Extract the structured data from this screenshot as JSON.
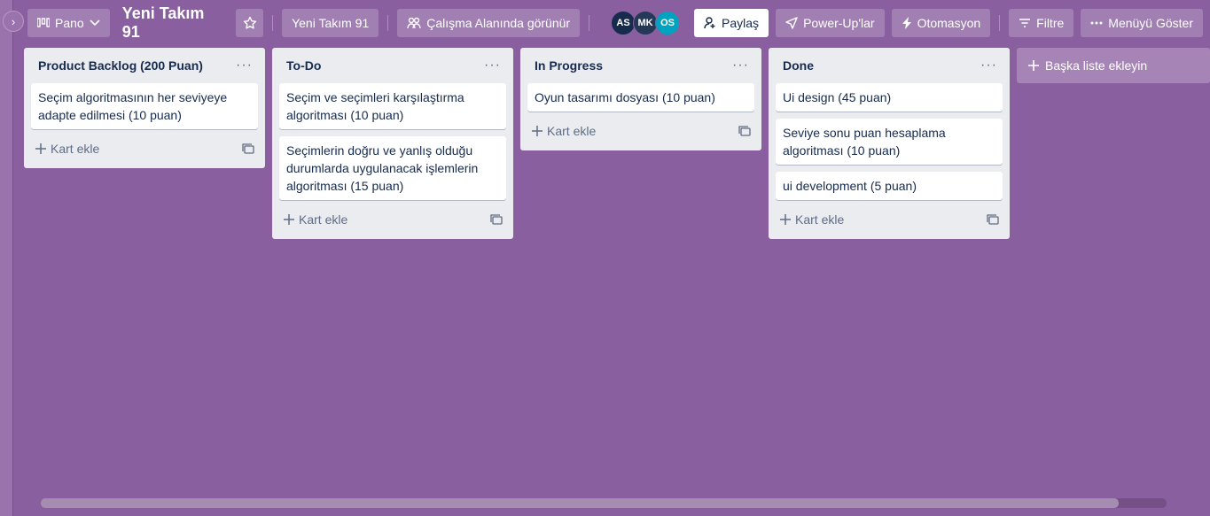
{
  "topbar": {
    "view_label": "Pano",
    "board_title": "Yeni Takım 91",
    "workspace_label": "Yeni Takım 91",
    "visibility_label": "Çalışma Alanında görünür",
    "share_label": "Paylaş",
    "powerups_label": "Power-Up'lar",
    "automation_label": "Otomasyon",
    "filter_label": "Filtre",
    "menu_label": "Menüyü Göster"
  },
  "members": [
    {
      "initials": "AS",
      "color": "#172b4d"
    },
    {
      "initials": "MK",
      "color": "#253858"
    },
    {
      "initials": "OS",
      "color": "#00a3bf"
    }
  ],
  "lists": [
    {
      "title": "Product Backlog (200 Puan)",
      "cards": [
        "Seçim algoritmasının her seviyeye adapte edilmesi (10 puan)"
      ],
      "add_card": "Kart ekle"
    },
    {
      "title": "To-Do",
      "cards": [
        "Seçim ve seçimleri karşılaştırma algoritması (10 puan)",
        "Seçimlerin doğru ve yanlış olduğu durumlarda uygulanacak işlemlerin algoritması (15 puan)"
      ],
      "add_card": "Kart ekle"
    },
    {
      "title": "In Progress",
      "cards": [
        "Oyun tasarımı dosyası (10 puan)"
      ],
      "add_card": "Kart ekle"
    },
    {
      "title": "Done",
      "cards": [
        "Ui design (45 puan)",
        "Seviye sonu puan hesaplama algoritması (10 puan)",
        "ui development (5 puan)"
      ],
      "add_card": "Kart ekle"
    }
  ],
  "add_list_label": "Başka liste ekleyin",
  "colors": {
    "background": "#8a5f9f",
    "list": "#ebecf0"
  }
}
